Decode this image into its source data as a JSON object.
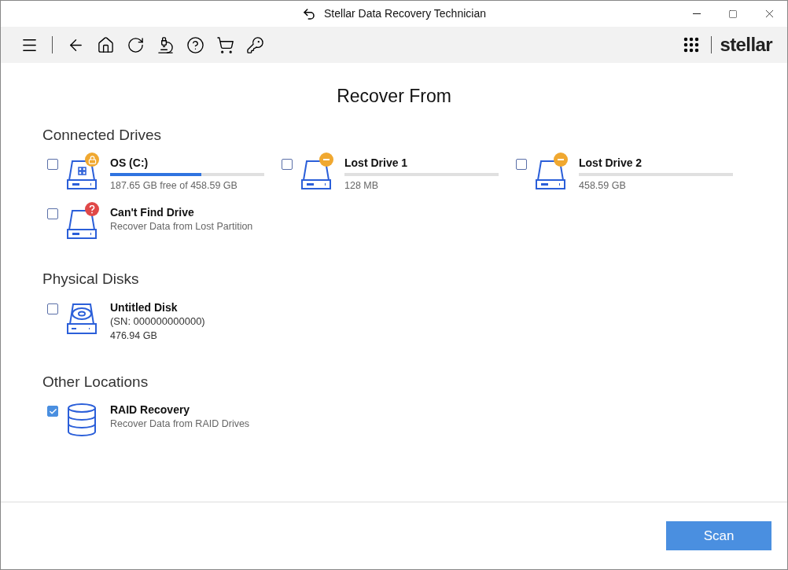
{
  "window": {
    "title": "Stellar Data Recovery Technician"
  },
  "logo": {
    "text": "stellar"
  },
  "heading": "Recover From",
  "sections": [
    {
      "title": "Connected Drives",
      "items": [
        {
          "kind": "drive",
          "name": "OS (C:)",
          "badge": {
            "kind": "lock"
          },
          "level": 0.59,
          "detail": "187.65 GB free of 458.59 GB",
          "checked": false
        },
        {
          "kind": "drive",
          "name": "Lost Drive 1",
          "badge": {
            "kind": "minus"
          },
          "detail": "128 MB",
          "checked": false
        },
        {
          "kind": "drive",
          "name": "Lost Drive 2",
          "badge": {
            "kind": "minus"
          },
          "detail": "458.59 GB",
          "checked": false
        },
        {
          "kind": "partition",
          "name": "Can't Find Drive",
          "badge": {
            "kind": "question"
          },
          "detail": "Recover Data from Lost Partition",
          "checked": false
        }
      ]
    },
    {
      "title": "Physical Disks",
      "items": [
        {
          "kind": "disk",
          "name": "Untitled Disk",
          "serial": "(SN: 000000000000)",
          "detail": "476.94 GB",
          "checked": false
        }
      ]
    },
    {
      "title": "Other Locations",
      "items": [
        {
          "kind": "raid",
          "name": "RAID Recovery",
          "detail": "Recover Data from RAID Drives",
          "checked": true
        }
      ]
    }
  ],
  "scan_button": "Scan"
}
